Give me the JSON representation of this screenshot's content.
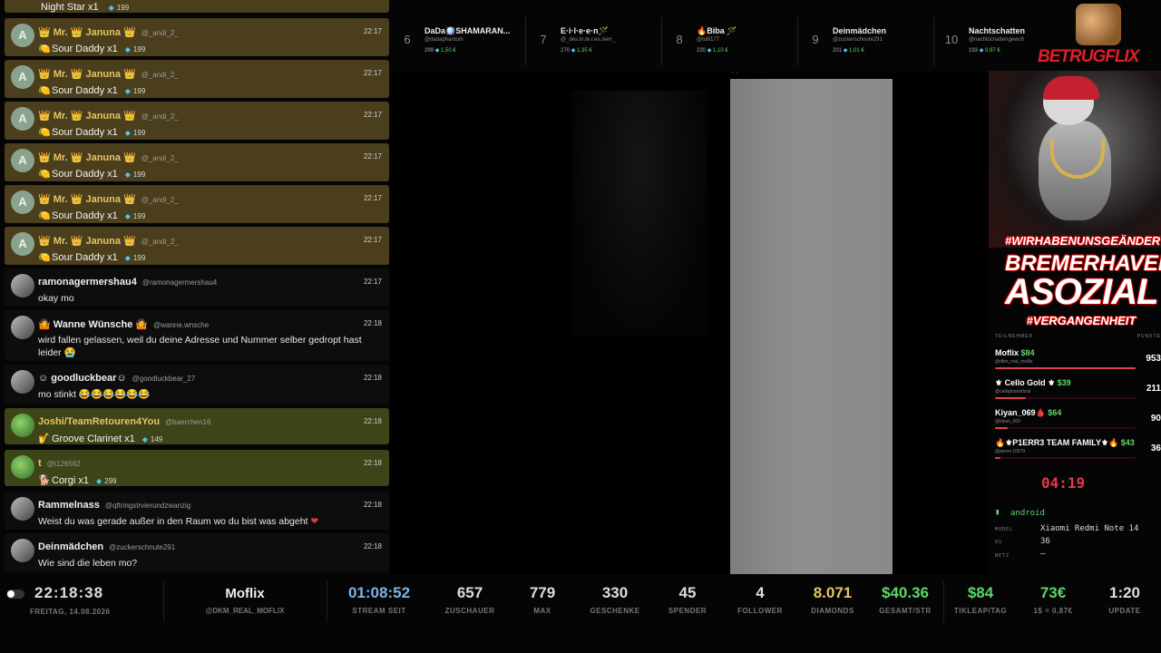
{
  "chat": {
    "top_partial": {
      "gift": "Night Star x1",
      "value": "199"
    },
    "messages": [
      {
        "avatar": "A",
        "name": "👑 Mr. 👑 Januna 👑",
        "handle": "@_andi_2_",
        "time": "22:17",
        "gift": "Sour Daddy x1",
        "value": "199"
      },
      {
        "avatar": "A",
        "name": "👑 Mr. 👑 Januna 👑",
        "handle": "@_andi_2_",
        "time": "22:17",
        "gift": "Sour Daddy x1",
        "value": "199"
      },
      {
        "avatar": "A",
        "name": "👑 Mr. 👑 Januna 👑",
        "handle": "@_andi_2_",
        "time": "22:17",
        "gift": "Sour Daddy x1",
        "value": "199"
      },
      {
        "avatar": "A",
        "name": "👑 Mr. 👑 Januna 👑",
        "handle": "@_andi_2_",
        "time": "22:17",
        "gift": "Sour Daddy x1",
        "value": "199"
      },
      {
        "avatar": "A",
        "name": "👑 Mr. 👑 Januna 👑",
        "handle": "@_andi_2_",
        "time": "22:17",
        "gift": "Sour Daddy x1",
        "value": "199"
      },
      {
        "avatar": "A",
        "name": "👑 Mr. 👑 Januna 👑",
        "handle": "@_andi_2_",
        "time": "22:17",
        "gift": "Sour Daddy x1",
        "value": "199"
      },
      {
        "name": "ramonagermershau4",
        "handle": "@ramonagermershau4",
        "time": "22:17",
        "text": "okay mo"
      },
      {
        "name": "🤷 Wanne Wünsche 🤷",
        "handle": "@wanne.wnsche",
        "time": "22:18",
        "text": "wird fallen gelassen, weil du deine Adresse und Nummer selber gedropt hast leider 😭"
      },
      {
        "name": "☺ goodluckbear☺",
        "handle": "@goodluckbear_27",
        "time": "22:18",
        "text": "mo stinkt 😂😂😂😂😂😂"
      },
      {
        "name": "Joshi/TeamRetouren4You",
        "handle": "@baerchen16",
        "time": "22:18",
        "gift": "Groove Clarinet x1",
        "value": "149"
      },
      {
        "name": "t",
        "handle": "@t126562",
        "time": "22:18",
        "gift": "Corgi x1",
        "value": "299"
      },
      {
        "name": "Rammelnass",
        "handle": "@qftringstrvierundzwanzig",
        "time": "22:18",
        "text": "Weist du was gerade außer in den Raum wo du bist was abgeht",
        "emoji": "❤"
      },
      {
        "name": "Deinmädchen",
        "handle": "@zuckerschnute291",
        "time": "22:18",
        "text": "Wie sind die leben mo?"
      }
    ]
  },
  "leaderboard": [
    {
      "rank": "6",
      "name": "DaDa🪩SHAMARAN...",
      "handle": "@dadaphantom",
      "count": "299",
      "money": "1,50 €"
    },
    {
      "rank": "7",
      "name": "E·i·l·e·e·n🪄",
      "handle": "@_des.in.te.r.es.sierr_",
      "count": "270",
      "money": "1,35 €"
    },
    {
      "rank": "8",
      "name": "🔥Biba 🪄",
      "handle": "@tulli177",
      "count": "220",
      "money": "1,10 €"
    },
    {
      "rank": "9",
      "name": "Deinmädchen",
      "handle": "@zuckerschnute291",
      "count": "201",
      "money": "1,01 €"
    },
    {
      "rank": "10",
      "name": "Nachtschatten",
      "handle": "@nachtschattengewc8",
      "count": "193",
      "money": "0,97 €"
    }
  ],
  "overlay": {
    "logo": "BETRUGFLIX",
    "slogan_1": "#WIRHABENUNSGEÄNDERT",
    "slogan_2": "BREMERHAVEN",
    "slogan_3": "ASOZIAL",
    "slogan_4": "#VERGANGENHEIT",
    "ranking_header_left": "TEILNEHMER",
    "ranking_header_right": "PUNKTE",
    "ranking": [
      {
        "name": "Moflix",
        "dollars": "$84",
        "handle": "@dkm_real_moflix",
        "points": "953",
        "fill": 1.0
      },
      {
        "name": "⚜ Cello Gold ⚜",
        "dollars": "$39",
        "handle": "@cellophanoficial",
        "points": "211",
        "fill": 0.22
      },
      {
        "name": "Kiyan_069🩸",
        "dollars": "$64",
        "handle": "@kiyan_069",
        "points": "90",
        "fill": 0.09
      },
      {
        "name": "🔥⚜P1ERR3 TEAM FAMILY⚜🔥",
        "dollars": "$43",
        "handle": "@pierre.10579",
        "points": "36",
        "fill": 0.04
      }
    ],
    "timer": "04:19",
    "device": {
      "os": "android",
      "model_label": "MODEL",
      "model": "Xiaomi Redmi Note 14",
      "os_label": "OS",
      "os_version": "36",
      "net_label": "NETZ",
      "net": "—"
    }
  },
  "stats": {
    "clock": "22:18:38",
    "date": "FREITAG, 14.08.2026",
    "user": "Moflix",
    "handle": "@DKM_REAL_MOFLIX",
    "items": [
      {
        "value": "01:08:52",
        "label": "STREAM SEIT",
        "color": "#7fb2e6"
      },
      {
        "value": "657",
        "label": "ZUSCHAUER",
        "color": "#dddddd"
      },
      {
        "value": "779",
        "label": "MAX",
        "color": "#dddddd"
      },
      {
        "value": "330",
        "label": "GESCHENKE",
        "color": "#dddddd"
      },
      {
        "value": "45",
        "label": "SPENDER",
        "color": "#dddddd"
      },
      {
        "value": "4",
        "label": "FOLLOWER",
        "color": "#dddddd"
      },
      {
        "value": "8.071",
        "label": "DIAMONDS",
        "color": "#e7c463"
      },
      {
        "value": "$40.36",
        "label": "GESAMT/STR",
        "color": "#5fd66b"
      },
      {
        "value": "$84",
        "label": "TIKLEAP/TAG",
        "color": "#5fd66b"
      },
      {
        "value": "73€",
        "label": "1$ = 0,87€",
        "color": "#5fd66b"
      },
      {
        "value": "1:20",
        "label": "UPDATE",
        "color": "#dddddd"
      }
    ]
  }
}
